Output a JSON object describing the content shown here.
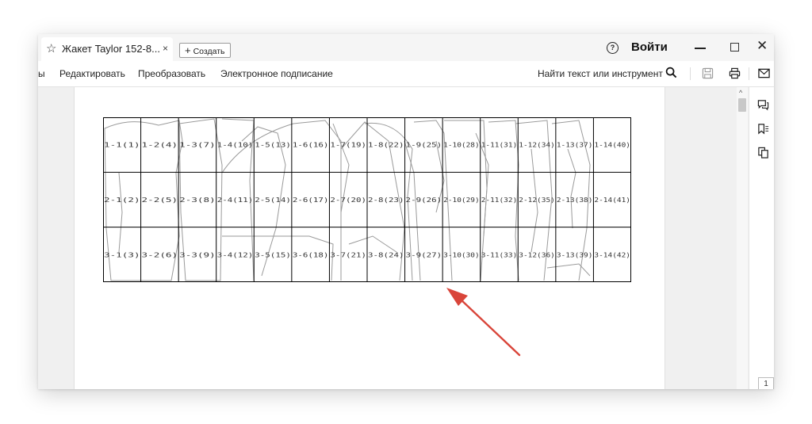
{
  "tab": {
    "title": "Жакет Taylor 152-8...",
    "close": "×",
    "star_icon": "star-icon"
  },
  "new_tab": {
    "label": "Создать",
    "plus": "+"
  },
  "titlebar": {
    "help": "?",
    "login": "Войти",
    "close": "✕"
  },
  "menu": {
    "partial": "ы",
    "items": [
      "Редактировать",
      "Преобразовать",
      "Электронное подписание"
    ],
    "search_label": "Найти текст или инструмент"
  },
  "scroll_up": "^",
  "page_number": "1",
  "grid_labels": [
    [
      "1-1(1)",
      "1-2(4)",
      "1-3(7)",
      "1-4(10)",
      "1-5(13)",
      "1-6(16)",
      "1-7(19)",
      "1-8(22)",
      "1-9(25)",
      "1-10(28)",
      "1-11(31)",
      "1-12(34)",
      "1-13(37)",
      "1-14(40)"
    ],
    [
      "2-1(2)",
      "2-2(5)",
      "2-3(8)",
      "2-4(11)",
      "2-5(14)",
      "2-6(17)",
      "2-7(20)",
      "2-8(23)",
      "2-9(26)",
      "2-10(29)",
      "2-11(32)",
      "2-12(35)",
      "2-13(38)",
      "2-14(41)"
    ],
    [
      "3-1(3)",
      "3-2(6)",
      "3-3(9)",
      "3-4(12)",
      "3-5(15)",
      "3-6(18)",
      "3-7(21)",
      "3-8(24)",
      "3-9(27)",
      "3-10(30)",
      "3-11(33)",
      "3-12(36)",
      "3-13(39)",
      "3-14(42)"
    ]
  ],
  "colors": {
    "annotation_arrow": "#d9453a",
    "pattern_lines": "#9a9a9a",
    "grid": "#000000"
  }
}
